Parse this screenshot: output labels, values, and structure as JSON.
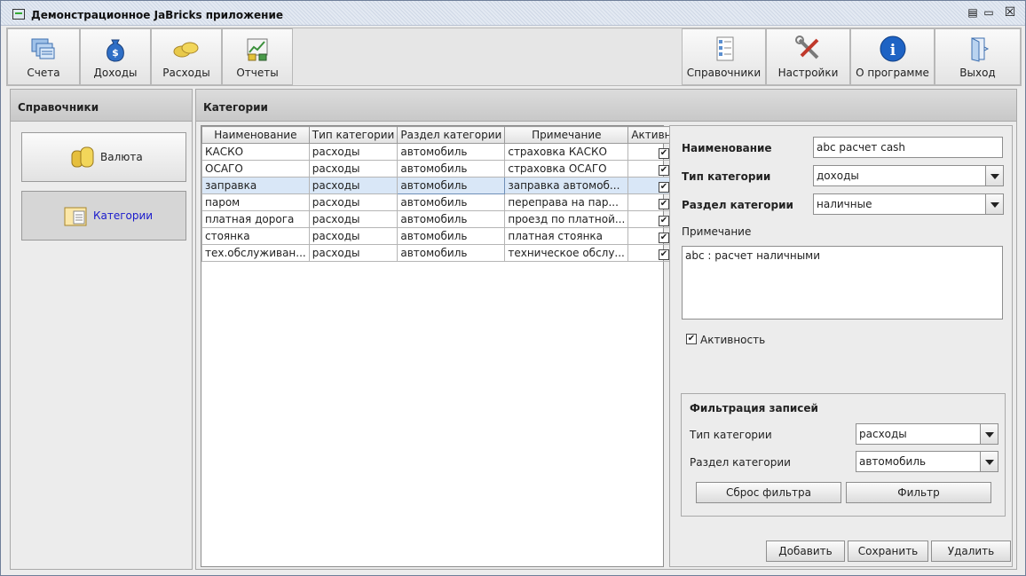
{
  "window": {
    "title": "Демонстрационное JaBricks приложение"
  },
  "toolbar": {
    "left": [
      {
        "label": "Счета",
        "icon": "accounts-icon"
      },
      {
        "label": "Доходы",
        "icon": "money-bag-icon"
      },
      {
        "label": "Расходы",
        "icon": "coins-icon"
      },
      {
        "label": "Отчеты",
        "icon": "reports-icon"
      }
    ],
    "right": [
      {
        "label": "Справочники",
        "icon": "directory-icon"
      },
      {
        "label": "Настройки",
        "icon": "tools-icon"
      },
      {
        "label": "О программе",
        "icon": "info-icon"
      },
      {
        "label": "Выход",
        "icon": "exit-door-icon"
      }
    ]
  },
  "sidebar": {
    "header": "Справочники",
    "items": [
      {
        "label": "Валюта",
        "icon": "coins-stack-icon"
      },
      {
        "label": "Категории",
        "icon": "folder-list-icon"
      }
    ]
  },
  "main": {
    "header": "Категории",
    "table": {
      "columns": [
        "Наименование",
        "Тип категории",
        "Раздел категории",
        "Примечание",
        "Активность"
      ],
      "rows": [
        [
          "КАСКО",
          "расходы",
          "автомобиль",
          "страховка КАСКО",
          true
        ],
        [
          "ОСАГО",
          "расходы",
          "автомобиль",
          "страховка ОСАГО",
          true
        ],
        [
          "заправка",
          "расходы",
          "автомобиль",
          "заправка автомоб...",
          true
        ],
        [
          "паром",
          "расходы",
          "автомобиль",
          "переправа на пар...",
          true
        ],
        [
          "платная дорога",
          "расходы",
          "автомобиль",
          "проезд по платной...",
          true
        ],
        [
          "стоянка",
          "расходы",
          "автомобиль",
          "платная стоянка",
          true
        ],
        [
          "тех.обслуживан...",
          "расходы",
          "автомобиль",
          "техническое обслу...",
          true
        ]
      ],
      "selected_row": 2
    },
    "form": {
      "name_label": "Наименование",
      "name_value": "abc расчет cash",
      "type_label": "Тип категории",
      "type_value": "доходы",
      "section_label": "Раздел категории",
      "section_value": "наличные",
      "note_label": "Примечание",
      "note_value": "abc : расчет наличными",
      "active_label": "Активность",
      "active_checked": true,
      "filter": {
        "title": "Фильтрация записей",
        "type_label": "Тип категории",
        "type_value": "расходы",
        "section_label": "Раздел категории",
        "section_value": "автомобиль",
        "reset_button": "Сброс фильтра",
        "apply_button": "Фильтр"
      },
      "buttons": {
        "add": "Добавить",
        "save": "Сохранить",
        "delete": "Удалить"
      }
    }
  },
  "colors": {
    "selection": "#d9e7f7",
    "link_blue": "#1a1acc"
  }
}
